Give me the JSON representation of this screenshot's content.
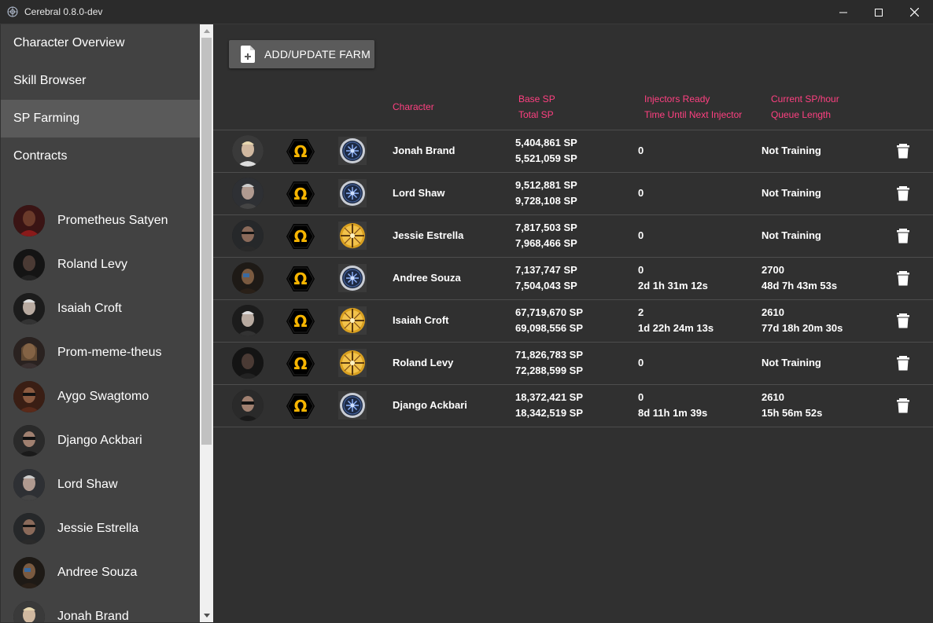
{
  "window": {
    "title": "Cerebral 0.8.0-dev"
  },
  "sidebar": {
    "nav": [
      {
        "label": "Character Overview"
      },
      {
        "label": "Skill Browser"
      },
      {
        "label": "SP Farming"
      },
      {
        "label": "Contracts"
      }
    ],
    "characters": [
      {
        "name": "Prometheus Satyen"
      },
      {
        "name": "Roland Levy"
      },
      {
        "name": "Isaiah Croft"
      },
      {
        "name": "Prom-meme-theus"
      },
      {
        "name": "Aygo Swagtomo"
      },
      {
        "name": "Django Ackbari"
      },
      {
        "name": "Lord Shaw"
      },
      {
        "name": "Jessie Estrella"
      },
      {
        "name": "Andree Souza"
      },
      {
        "name": "Jonah Brand"
      }
    ]
  },
  "toolbar": {
    "add_farm_label": "ADD/UPDATE FARM"
  },
  "table": {
    "headers": {
      "character": "Character",
      "base_sp": "Base SP",
      "total_sp": "Total SP",
      "injectors_ready": "Injectors Ready",
      "time_until_next": "Time Until Next Injector",
      "current_sp_hour": "Current SP/hour",
      "queue_length": "Queue Length"
    },
    "rows": [
      {
        "character": "Jonah Brand",
        "base_sp": "5,404,861 SP",
        "total_sp": "5,521,059 SP",
        "injectors": "0",
        "next_injector": "",
        "sp_hour": "Not Training",
        "queue": "",
        "implant": "blue"
      },
      {
        "character": "Lord Shaw",
        "base_sp": "9,512,881 SP",
        "total_sp": "9,728,108 SP",
        "injectors": "0",
        "next_injector": "",
        "sp_hour": "Not Training",
        "queue": "",
        "implant": "blue"
      },
      {
        "character": "Jessie Estrella",
        "base_sp": "7,817,503 SP",
        "total_sp": "7,968,466 SP",
        "injectors": "0",
        "next_injector": "",
        "sp_hour": "Not Training",
        "queue": "",
        "implant": "gold"
      },
      {
        "character": "Andree Souza",
        "base_sp": "7,137,747 SP",
        "total_sp": "7,504,043 SP",
        "injectors": "0",
        "next_injector": "2d 1h 31m 12s",
        "sp_hour": "2700",
        "queue": "48d 7h 43m 53s",
        "implant": "blue"
      },
      {
        "character": "Isaiah Croft",
        "base_sp": "67,719,670 SP",
        "total_sp": "69,098,556 SP",
        "injectors": "2",
        "next_injector": "1d 22h 24m 13s",
        "sp_hour": "2610",
        "queue": "77d 18h 20m 30s",
        "implant": "gold"
      },
      {
        "character": "Roland Levy",
        "base_sp": "71,826,783 SP",
        "total_sp": "72,288,599 SP",
        "injectors": "0",
        "next_injector": "",
        "sp_hour": "Not Training",
        "queue": "",
        "implant": "gold"
      },
      {
        "character": "Django Ackbari",
        "base_sp": "18,372,421 SP",
        "total_sp": "18,342,519 SP",
        "injectors": "0",
        "next_injector": "8d 11h 1m 39s",
        "sp_hour": "2610",
        "queue": "15h 56m 52s",
        "implant": "blue"
      }
    ]
  },
  "colors": {
    "accent": "#ff4081",
    "omega": "#f7b500",
    "background": "#303030",
    "sidebar": "#424242"
  }
}
